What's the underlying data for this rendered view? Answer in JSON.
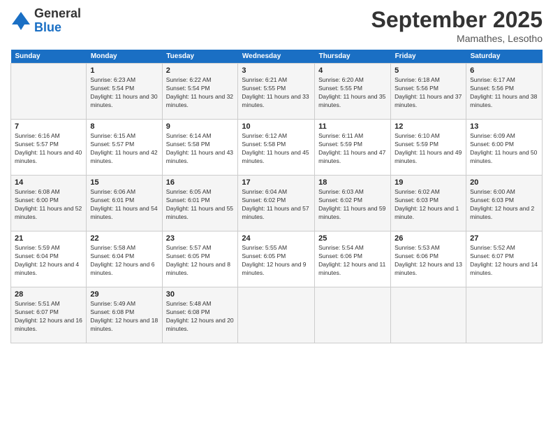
{
  "logo": {
    "general": "General",
    "blue": "Blue"
  },
  "header": {
    "title": "September 2025",
    "location": "Mamathes, Lesotho"
  },
  "days_of_week": [
    "Sunday",
    "Monday",
    "Tuesday",
    "Wednesday",
    "Thursday",
    "Friday",
    "Saturday"
  ],
  "weeks": [
    [
      {
        "num": "",
        "sunrise": "",
        "sunset": "",
        "daylight": ""
      },
      {
        "num": "1",
        "sunrise": "Sunrise: 6:23 AM",
        "sunset": "Sunset: 5:54 PM",
        "daylight": "Daylight: 11 hours and 30 minutes."
      },
      {
        "num": "2",
        "sunrise": "Sunrise: 6:22 AM",
        "sunset": "Sunset: 5:54 PM",
        "daylight": "Daylight: 11 hours and 32 minutes."
      },
      {
        "num": "3",
        "sunrise": "Sunrise: 6:21 AM",
        "sunset": "Sunset: 5:55 PM",
        "daylight": "Daylight: 11 hours and 33 minutes."
      },
      {
        "num": "4",
        "sunrise": "Sunrise: 6:20 AM",
        "sunset": "Sunset: 5:55 PM",
        "daylight": "Daylight: 11 hours and 35 minutes."
      },
      {
        "num": "5",
        "sunrise": "Sunrise: 6:18 AM",
        "sunset": "Sunset: 5:56 PM",
        "daylight": "Daylight: 11 hours and 37 minutes."
      },
      {
        "num": "6",
        "sunrise": "Sunrise: 6:17 AM",
        "sunset": "Sunset: 5:56 PM",
        "daylight": "Daylight: 11 hours and 38 minutes."
      }
    ],
    [
      {
        "num": "7",
        "sunrise": "Sunrise: 6:16 AM",
        "sunset": "Sunset: 5:57 PM",
        "daylight": "Daylight: 11 hours and 40 minutes."
      },
      {
        "num": "8",
        "sunrise": "Sunrise: 6:15 AM",
        "sunset": "Sunset: 5:57 PM",
        "daylight": "Daylight: 11 hours and 42 minutes."
      },
      {
        "num": "9",
        "sunrise": "Sunrise: 6:14 AM",
        "sunset": "Sunset: 5:58 PM",
        "daylight": "Daylight: 11 hours and 43 minutes."
      },
      {
        "num": "10",
        "sunrise": "Sunrise: 6:12 AM",
        "sunset": "Sunset: 5:58 PM",
        "daylight": "Daylight: 11 hours and 45 minutes."
      },
      {
        "num": "11",
        "sunrise": "Sunrise: 6:11 AM",
        "sunset": "Sunset: 5:59 PM",
        "daylight": "Daylight: 11 hours and 47 minutes."
      },
      {
        "num": "12",
        "sunrise": "Sunrise: 6:10 AM",
        "sunset": "Sunset: 5:59 PM",
        "daylight": "Daylight: 11 hours and 49 minutes."
      },
      {
        "num": "13",
        "sunrise": "Sunrise: 6:09 AM",
        "sunset": "Sunset: 6:00 PM",
        "daylight": "Daylight: 11 hours and 50 minutes."
      }
    ],
    [
      {
        "num": "14",
        "sunrise": "Sunrise: 6:08 AM",
        "sunset": "Sunset: 6:00 PM",
        "daylight": "Daylight: 11 hours and 52 minutes."
      },
      {
        "num": "15",
        "sunrise": "Sunrise: 6:06 AM",
        "sunset": "Sunset: 6:01 PM",
        "daylight": "Daylight: 11 hours and 54 minutes."
      },
      {
        "num": "16",
        "sunrise": "Sunrise: 6:05 AM",
        "sunset": "Sunset: 6:01 PM",
        "daylight": "Daylight: 11 hours and 55 minutes."
      },
      {
        "num": "17",
        "sunrise": "Sunrise: 6:04 AM",
        "sunset": "Sunset: 6:02 PM",
        "daylight": "Daylight: 11 hours and 57 minutes."
      },
      {
        "num": "18",
        "sunrise": "Sunrise: 6:03 AM",
        "sunset": "Sunset: 6:02 PM",
        "daylight": "Daylight: 11 hours and 59 minutes."
      },
      {
        "num": "19",
        "sunrise": "Sunrise: 6:02 AM",
        "sunset": "Sunset: 6:03 PM",
        "daylight": "Daylight: 12 hours and 1 minute."
      },
      {
        "num": "20",
        "sunrise": "Sunrise: 6:00 AM",
        "sunset": "Sunset: 6:03 PM",
        "daylight": "Daylight: 12 hours and 2 minutes."
      }
    ],
    [
      {
        "num": "21",
        "sunrise": "Sunrise: 5:59 AM",
        "sunset": "Sunset: 6:04 PM",
        "daylight": "Daylight: 12 hours and 4 minutes."
      },
      {
        "num": "22",
        "sunrise": "Sunrise: 5:58 AM",
        "sunset": "Sunset: 6:04 PM",
        "daylight": "Daylight: 12 hours and 6 minutes."
      },
      {
        "num": "23",
        "sunrise": "Sunrise: 5:57 AM",
        "sunset": "Sunset: 6:05 PM",
        "daylight": "Daylight: 12 hours and 8 minutes."
      },
      {
        "num": "24",
        "sunrise": "Sunrise: 5:55 AM",
        "sunset": "Sunset: 6:05 PM",
        "daylight": "Daylight: 12 hours and 9 minutes."
      },
      {
        "num": "25",
        "sunrise": "Sunrise: 5:54 AM",
        "sunset": "Sunset: 6:06 PM",
        "daylight": "Daylight: 12 hours and 11 minutes."
      },
      {
        "num": "26",
        "sunrise": "Sunrise: 5:53 AM",
        "sunset": "Sunset: 6:06 PM",
        "daylight": "Daylight: 12 hours and 13 minutes."
      },
      {
        "num": "27",
        "sunrise": "Sunrise: 5:52 AM",
        "sunset": "Sunset: 6:07 PM",
        "daylight": "Daylight: 12 hours and 14 minutes."
      }
    ],
    [
      {
        "num": "28",
        "sunrise": "Sunrise: 5:51 AM",
        "sunset": "Sunset: 6:07 PM",
        "daylight": "Daylight: 12 hours and 16 minutes."
      },
      {
        "num": "29",
        "sunrise": "Sunrise: 5:49 AM",
        "sunset": "Sunset: 6:08 PM",
        "daylight": "Daylight: 12 hours and 18 minutes."
      },
      {
        "num": "30",
        "sunrise": "Sunrise: 5:48 AM",
        "sunset": "Sunset: 6:08 PM",
        "daylight": "Daylight: 12 hours and 20 minutes."
      },
      {
        "num": "",
        "sunrise": "",
        "sunset": "",
        "daylight": ""
      },
      {
        "num": "",
        "sunrise": "",
        "sunset": "",
        "daylight": ""
      },
      {
        "num": "",
        "sunrise": "",
        "sunset": "",
        "daylight": ""
      },
      {
        "num": "",
        "sunrise": "",
        "sunset": "",
        "daylight": ""
      }
    ]
  ]
}
